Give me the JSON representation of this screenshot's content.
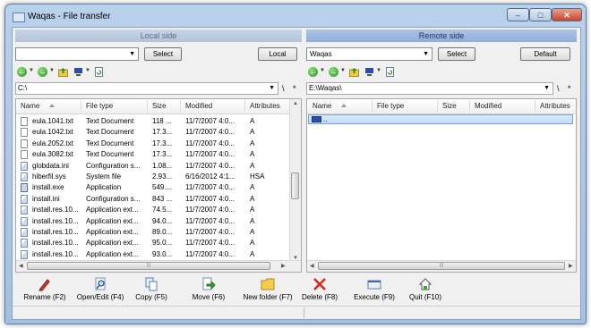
{
  "window": {
    "title": "Waqas - File transfer"
  },
  "local": {
    "header": "Local side",
    "drive_value": "",
    "select_label": "Select",
    "location_label": "Local",
    "path": "C:\\",
    "columns": [
      "Name",
      "File type",
      "Size",
      "Modified",
      "Attributes"
    ],
    "files": [
      {
        "name": "eula.1041.txt",
        "type": "Text Document",
        "size": "118 ...",
        "modified": "11/7/2007 4:0...",
        "attr": "A",
        "icon": "text-file-icon"
      },
      {
        "name": "eula.1042.txt",
        "type": "Text Document",
        "size": "17.3...",
        "modified": "11/7/2007 4:0...",
        "attr": "A",
        "icon": "text-file-icon"
      },
      {
        "name": "eula.2052.txt",
        "type": "Text Document",
        "size": "17.3...",
        "modified": "11/7/2007 4:0...",
        "attr": "A",
        "icon": "text-file-icon"
      },
      {
        "name": "eula.3082.txt",
        "type": "Text Document",
        "size": "17.3...",
        "modified": "11/7/2007 4:0...",
        "attr": "A",
        "icon": "text-file-icon"
      },
      {
        "name": "globdata.ini",
        "type": "Configuration s...",
        "size": "1.08...",
        "modified": "11/7/2007 4:0...",
        "attr": "A",
        "icon": "config-file-icon"
      },
      {
        "name": "hiberfil.sys",
        "type": "System file",
        "size": "2.93...",
        "modified": "6/16/2012 4:1...",
        "attr": "HSA",
        "icon": "config-file-icon"
      },
      {
        "name": "install.exe",
        "type": "Application",
        "size": "549....",
        "modified": "11/7/2007 4:0...",
        "attr": "A",
        "icon": "application-icon"
      },
      {
        "name": "install.ini",
        "type": "Configuration s...",
        "size": "843 ...",
        "modified": "11/7/2007 4:0...",
        "attr": "A",
        "icon": "config-file-icon"
      },
      {
        "name": "install.res.10...",
        "type": "Application ext...",
        "size": "74.5...",
        "modified": "11/7/2007 4:0...",
        "attr": "A",
        "icon": "config-file-icon"
      },
      {
        "name": "install.res.10...",
        "type": "Application ext...",
        "size": "94.0...",
        "modified": "11/7/2007 4:0...",
        "attr": "A",
        "icon": "config-file-icon"
      },
      {
        "name": "install.res.10...",
        "type": "Application ext...",
        "size": "89.0...",
        "modified": "11/7/2007 4:0...",
        "attr": "A",
        "icon": "config-file-icon"
      },
      {
        "name": "install.res.10...",
        "type": "Application ext...",
        "size": "95.0...",
        "modified": "11/7/2007 4:0...",
        "attr": "A",
        "icon": "config-file-icon"
      },
      {
        "name": "install.res.10...",
        "type": "Application ext...",
        "size": "93.0...",
        "modified": "11/7/2007 4:0...",
        "attr": "A",
        "icon": "config-file-icon"
      }
    ]
  },
  "remote": {
    "header": "Remote side",
    "host_value": "Waqas",
    "select_label": "Select",
    "location_label": "Default",
    "path": "E:\\Waqas\\",
    "columns": [
      "Name",
      "File type",
      "Size",
      "Modified",
      "Attributes"
    ],
    "files": [
      {
        "name": "..",
        "icon": "parent-folder-icon"
      }
    ]
  },
  "pathbar_symbols": {
    "separator": "\\",
    "star": "*"
  },
  "toolbar": [
    {
      "label": "Rename (F2)",
      "icon": "pencil-icon"
    },
    {
      "label": "Open/Edit (F4)",
      "icon": "magnifier-icon"
    },
    {
      "label": "Copy (F5)",
      "icon": "copy-icon"
    },
    {
      "label": "Move (F6)",
      "icon": "move-icon"
    },
    {
      "label": "New folder (F7)",
      "icon": "folder-icon"
    },
    {
      "label": "Delete (F8)",
      "icon": "delete-x-icon"
    },
    {
      "label": "Execute (F9)",
      "icon": "execute-icon"
    },
    {
      "label": "Quit (F10)",
      "icon": "quit-icon"
    }
  ]
}
